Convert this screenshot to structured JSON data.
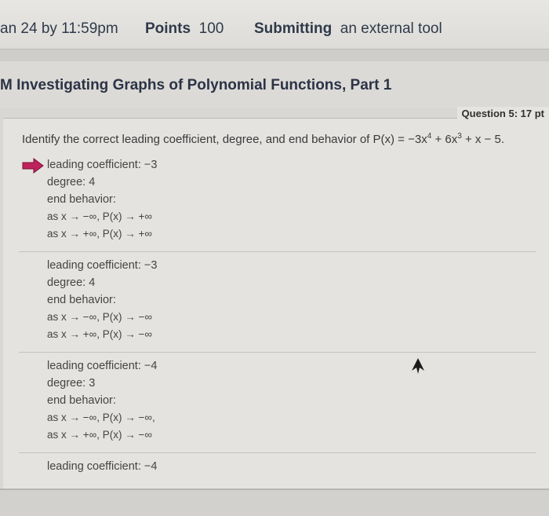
{
  "header": {
    "due": "an 24 by 11:59pm",
    "points_label": "Points",
    "points_value": "100",
    "submitting_label": "Submitting",
    "submitting_value": "an external tool"
  },
  "page": {
    "title": "M Investigating Graphs of Polynomial Functions, Part 1",
    "question_number": "Question 5: 17 pt"
  },
  "question": {
    "prompt_pre": "Identify the correct leading coefficient, degree, and end behavior of P(x) = −3x",
    "exp1": "4",
    "prompt_mid": " + 6x",
    "exp2": "3",
    "prompt_post": " + x − 5."
  },
  "choices": [
    {
      "leading": "leading coefficient: −3",
      "degree": "degree: 4",
      "end": "end behavior:",
      "left": "as x → −∞, P(x) → +∞",
      "right": "as x → +∞, P(x) → +∞"
    },
    {
      "leading": "leading coefficient: −3",
      "degree": "degree: 4",
      "end": "end behavior:",
      "left": "as x → −∞, P(x) → −∞",
      "right": "as x → +∞, P(x) → −∞"
    },
    {
      "leading": "leading coefficient: −4",
      "degree": "degree: 3",
      "end": "end behavior:",
      "left": "as x → −∞, P(x) → −∞,",
      "right": "as x → +∞, P(x) → −∞"
    },
    {
      "leading": "leading coefficient: −4"
    }
  ],
  "colors": {
    "selected_arrow": "#c0235b",
    "title": "#2b3346"
  },
  "icons": {
    "selected_marker": "arrow-right-icon",
    "mouse": "cursor-icon"
  }
}
